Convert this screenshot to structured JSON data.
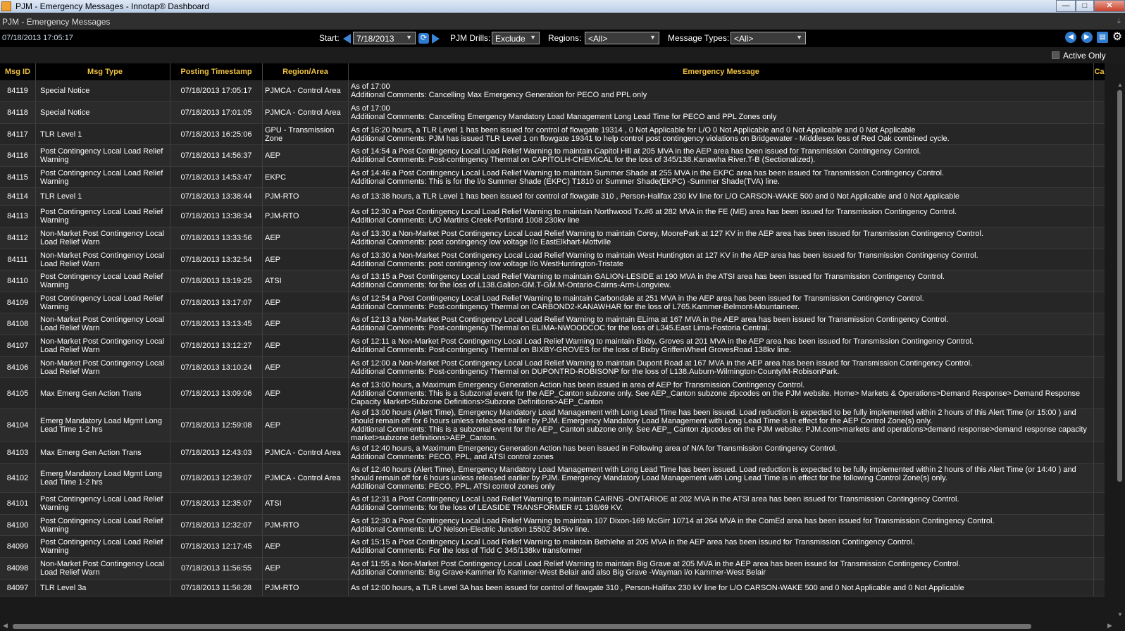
{
  "window": {
    "title": "PJM - Emergency Messages - Innotap® Dashboard",
    "minimize": "—",
    "maximize": "□",
    "close": "✕"
  },
  "panel": {
    "title": "PJM - Emergency Messages",
    "pin": "⇣"
  },
  "toolbar": {
    "clock": "07/18/2013 17:05:17",
    "start_label": "Start:",
    "start_date": "7/18/2013",
    "drills_label": "PJM Drills:",
    "drills_value": "Exclude",
    "regions_label": "Regions:",
    "regions_value": "<All>",
    "types_label": "Message Types:",
    "types_value": "<All>",
    "icons": [
      "back-icon",
      "forward-icon",
      "export-icon",
      "gear-icon"
    ]
  },
  "options": {
    "active_only_label": "Active Only",
    "active_only_checked": false
  },
  "table": {
    "columns": {
      "id": "Msg ID",
      "type": "Msg Type",
      "ts": "Posting Timestamp",
      "region": "Region/Area",
      "msg": "Emergency Message",
      "ca": "Ca"
    },
    "rows": [
      {
        "id": "84119",
        "type": "Special Notice",
        "ts": "07/18/2013 17:05:17",
        "region": "PJMCA - Control Area",
        "msg": "As of 17:00\nAdditional Comments: Cancelling Max Emergency Generation for PECO and PPL only"
      },
      {
        "id": "84118",
        "type": "Special Notice",
        "ts": "07/18/2013 17:01:05",
        "region": "PJMCA - Control Area",
        "msg": "As of 17:00\nAdditional Comments: Cancelling Emergency Mandatory Load Management Long Lead Time for PECO and PPL Zones only"
      },
      {
        "id": "84117",
        "type": "TLR Level 1",
        "ts": "07/18/2013 16:25:06",
        "region": "GPU - Transmission Zone",
        "msg": "As of 16:20 hours, a TLR Level 1 has been issued for control of flowgate 19314 , 0 Not Applicable for L/O 0 Not Applicable and 0 Not Applicable and 0 Not Applicable\nAdditional Comments: PJM has issued TLR Level 1 on flowgate 19341 to help control post contingency violations on Bridgewater - Middlesex loss of Red Oak combined cycle."
      },
      {
        "id": "84116",
        "type": "Post Contingency Local Load Relief Warning",
        "ts": "07/18/2013 14:56:37",
        "region": "AEP",
        "msg": "As of 14:54 a Post Contingency Local Load Relief Warning to maintain Capitol Hill at 205   MVA in the AEP area has been issued for Transmission Contingency Control.\nAdditional Comments: Post-contingency Thermal on CAPITOLH-CHEMICAL for the loss of 345/138.Kanawha River.T-B (Sectionalized)."
      },
      {
        "id": "84115",
        "type": "Post Contingency Local Load Relief Warning",
        "ts": "07/18/2013 14:53:47",
        "region": "EKPC",
        "msg": "As of 14:46 a Post Contingency Local Load Relief Warning to maintain Summer Shade at 255   MVA in the EKPC area has been issued for Transmission Contingency Control.\nAdditional Comments: This is for the l/o Summer Shade (EKPC) T1810 or Summer Shade(EKPC) -Summer Shade(TVA) line."
      },
      {
        "id": "84114",
        "type": "TLR Level 1",
        "ts": "07/18/2013 13:38:44",
        "region": "PJM-RTO",
        "msg": "As of 13:38 hours, a TLR Level 1 has been issued for control of flowgate 310 , Person-Halifax 230 kV line for L/O CARSON-WAKE 500 and 0 Not Applicable and 0 Not Applicable"
      },
      {
        "id": "84113",
        "type": "Post Contingency Local Load Relief Warning",
        "ts": "07/18/2013 13:38:34",
        "region": "PJM-RTO",
        "msg": "As of 12:30 a Post Contingency Local Load Relief Warning to maintain Northwood Tx.#6 at 282   MVA in the FE (ME) area has been issued for Transmission Contingency Control.\nAdditional Comments: L/O Martins Creek-Portland 1008 230kv line"
      },
      {
        "id": "84112",
        "type": "Non-Market Post Contingency Local Load Relief Warn",
        "ts": "07/18/2013 13:33:56",
        "region": "AEP",
        "msg": "As of 13:30 a Non-Market Post Contingency Local Load Relief Warning to maintain  Corey, MoorePark at 127   KV in the AEP area has been issued for Transmission Contingency Control.\nAdditional Comments: post contingency low voltage l/o EastElkhart-Mottville"
      },
      {
        "id": "84111",
        "type": "Non-Market Post Contingency Local Load Relief Warn",
        "ts": "07/18/2013 13:32:54",
        "region": "AEP",
        "msg": "As of 13:30 a Non-Market Post Contingency Local Load Relief Warning to maintain  West Huntington at 127   KV in the AEP area has been issued for Transmission Contingency Control.\nAdditional Comments: post contingency low voltage l/o WestHuntington-Tristate"
      },
      {
        "id": "84110",
        "type": "Post Contingency Local Load Relief Warning",
        "ts": "07/18/2013 13:19:25",
        "region": "ATSI",
        "msg": "As of 13:15 a Post Contingency Local Load Relief Warning to maintain GALION-LESIDE  at 190   MVA in the ATSI area has been issued for Transmission Contingency Control.\nAdditional Comments: for the loss of L138.Galion-GM.T-GM.M-Ontario-Cairns-Arm-Longview."
      },
      {
        "id": "84109",
        "type": "Post Contingency Local Load Relief Warning",
        "ts": "07/18/2013 13:17:07",
        "region": "AEP",
        "msg": "As of 12:54 a Post Contingency Local Load Relief Warning to maintain Carbondale at 251   MVA in the AEP area has been issued for Transmission Contingency Control.\nAdditional Comments: Post-contingency Thermal on CARBOND2-KANAWHAR for the loss of L765.Kammer-Belmont-Mountaineer."
      },
      {
        "id": "84108",
        "type": "Non-Market Post Contingency Local Load Relief Warn",
        "ts": "07/18/2013 13:13:45",
        "region": "AEP",
        "msg": "As of 12:13 a Non-Market Post Contingency Local Load Relief Warning to maintain  ELima at 167   MVA in the AEP area has been issued for Transmission Contingency Control.\nAdditional Comments: Post-contingency Thermal on ELIMA-NWOODCOC for the loss of L345.East Lima-Fostoria Central."
      },
      {
        "id": "84107",
        "type": "Non-Market Post Contingency Local Load Relief Warn",
        "ts": "07/18/2013 13:12:27",
        "region": "AEP",
        "msg": "As of 12:11 a Non-Market Post Contingency Local Load Relief Warning to maintain  Bixby, Groves at 201   MVA in the AEP area has been issued for Transmission Contingency Control.\nAdditional Comments: Post-contingency Thermal on BIXBY-GROVES for the loss of Bixby GriffenWheel GrovesRoad 138kv line."
      },
      {
        "id": "84106",
        "type": "Non-Market Post Contingency Local Load Relief Warn",
        "ts": "07/18/2013 13:10:24",
        "region": "AEP",
        "msg": "As of 12:00 a Non-Market Post Contingency Local Load Relief Warning to maintain  Dupont Road at 167   MVA in the AEP area has been issued for Transmission Contingency Control.\nAdditional Comments: Post-contingency Thermal on DUPONTRD-ROBISONP for the loss of L138.Auburn-Wilmington-CountylM-RobisonPark."
      },
      {
        "id": "84105",
        "type": "Max Emerg Gen Action Trans",
        "ts": "07/18/2013 13:09:06",
        "region": "AEP",
        "msg": "As of 13:00 hours, a Maximum Emergency Generation Action has been issued in  area of AEP for Transmission Contingency Control.\nAdditional Comments: This is a Subzonal event for the AEP_Canton subzone only. See AEP_Canton subzone zipcodes on the PJM website. Home> Markets & Operations>Demand Response> Demand Response Capacity Market>Subzone Definitions>Subzone Definitions>AEP_Canton"
      },
      {
        "id": "84104",
        "type": "Emerg Mandatory Load Mgmt Long Lead Time 1-2 hrs",
        "ts": "07/18/2013 12:59:08",
        "region": "AEP",
        "msg": "As of 13:00 hours (Alert Time), Emergency Mandatory Load Management with Long Lead Time has been issued. Load reduction is expected to be fully implemented within 2 hours of this Alert Time (or 15:00 ) and should remain off for 6 hours unless released earlier by PJM. Emergency Mandatory Load Management with Long Lead Time is in effect for the  AEP Control Zone(s) only.\nAdditional Comments: This is a subzonal event for the AEP_ Canton subzone only. See AEP_ Canton zipcodes on the PJM website: PJM.com>markets and operations>demand response>demand response capacity market>subzone definitions>AEP_Canton."
      },
      {
        "id": "84103",
        "type": "Max Emerg Gen Action Trans",
        "ts": "07/18/2013 12:43:03",
        "region": "PJMCA - Control Area",
        "msg": "As of 12:40 hours, a Maximum Emergency Generation Action has been issued in Following area of N/A for Transmission Contingency Control.\nAdditional Comments: PECO, PPL, and ATSI control zones"
      },
      {
        "id": "84102",
        "type": "Emerg Mandatory Load Mgmt Long Lead Time 1-2 hrs",
        "ts": "07/18/2013 12:39:07",
        "region": "PJMCA - Control Area",
        "msg": "As of 12:40 hours (Alert Time), Emergency Mandatory Load Management with Long Lead Time has been issued. Load reduction is expected to be fully implemented within 2 hours of this Alert Time (or 14:40 ) and should remain off for 6 hours unless released earlier by PJM. Emergency Mandatory Load Management with Long Lead Time is in effect for the   following Control Zone(s) only.\nAdditional Comments: PECO, PPL, ATSI control zones only"
      },
      {
        "id": "84101",
        "type": "Post Contingency Local Load Relief Warning",
        "ts": "07/18/2013 12:35:07",
        "region": "ATSI",
        "msg": "As of 12:31 a Post Contingency Local Load Relief Warning to maintain CAIRNS  -ONTARIOE  at 202   MVA in the ATSI area has been issued for Transmission Contingency Control.\nAdditional Comments: for the loss of LEASIDE TRANSFORMER #1 138/69 KV."
      },
      {
        "id": "84100",
        "type": "Post Contingency Local Load Relief Warning",
        "ts": "07/18/2013 12:32:07",
        "region": "PJM-RTO",
        "msg": "As of 12:30 a Post Contingency Local Load Relief Warning to maintain 107 Dixon-169 McGirr 10714 at 264   MVA in the ComEd area has been issued for Transmission Contingency Control.\nAdditional Comments: L/O Nelson-Electric Junction 15502 345kv line."
      },
      {
        "id": "84099",
        "type": "Post Contingency Local Load Relief Warning",
        "ts": "07/18/2013 12:17:45",
        "region": "AEP",
        "msg": "As of 15:15 a Post Contingency Local Load Relief Warning to maintain Bethlehe at 205   MVA in the AEP area has been issued for Transmission Contingency Control.\nAdditional Comments: For the loss of Tidd C 345/138kv transformer"
      },
      {
        "id": "84098",
        "type": "Non-Market Post Contingency Local Load Relief Warn",
        "ts": "07/18/2013 11:56:55",
        "region": "AEP",
        "msg": "As of 11:55 a Non-Market Post Contingency Local Load Relief Warning to maintain  Big Grave at 205   MVA in the AEP area has been issued for Transmission Contingency Control.\nAdditional Comments: Big Grave-Kammer l/o Kammer-West Belair and also Big Grave -Wayman l/o Kammer-West Belair"
      },
      {
        "id": "84097",
        "type": "TLR Level 3a",
        "ts": "07/18/2013 11:56:28",
        "region": "PJM-RTO",
        "msg": "As of 12:00 hours, a TLR Level 3A has been issued for control of flowgate 310 , Person-Halifax 230 kV line for L/O CARSON-WAKE 500 and 0 Not Applicable and 0 Not Applicable"
      }
    ]
  }
}
